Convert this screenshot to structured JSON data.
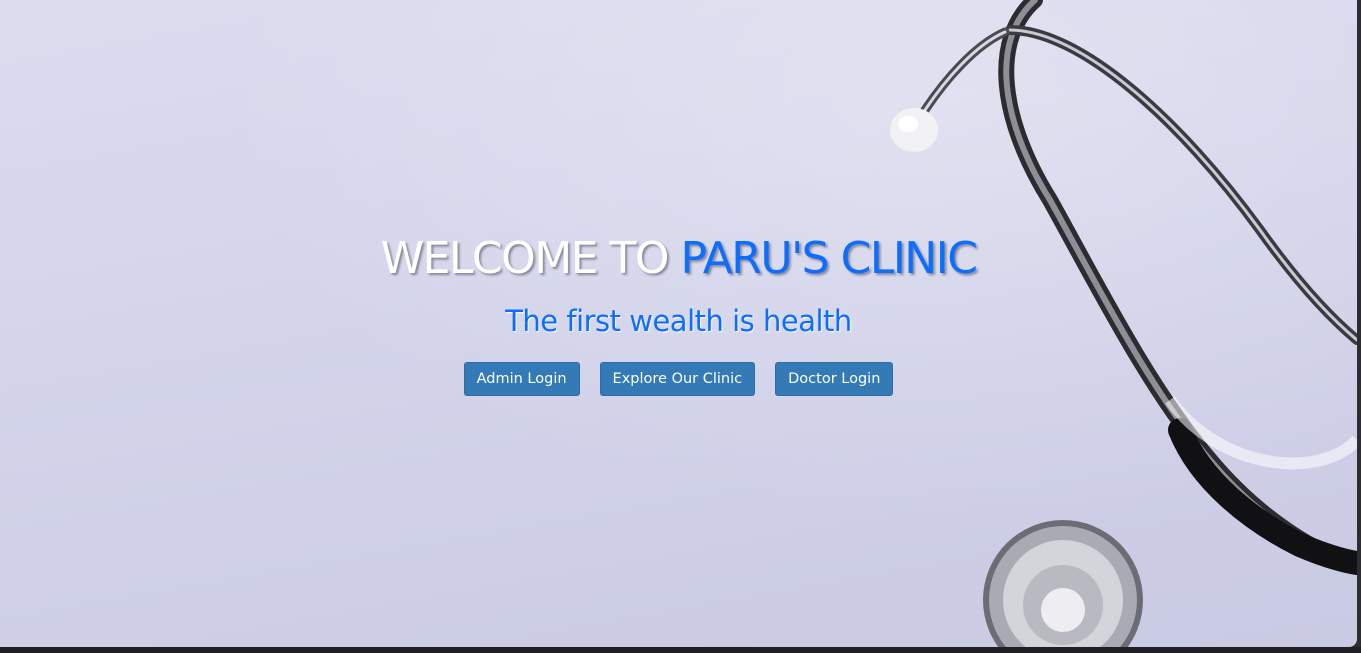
{
  "hero": {
    "title_prefix": "WELCOME TO ",
    "title_highlight": "PARU'S CLINIC",
    "tagline": "The first wealth is health"
  },
  "buttons": {
    "admin_login": "Admin Login",
    "explore_clinic": "Explore Our Clinic",
    "doctor_login": "Doctor Login"
  },
  "colors": {
    "accent_blue": "#0d6efd",
    "button_blue": "#337ab7",
    "background": "#d3d4ea"
  },
  "icons": {
    "background_image": "stethoscope-image"
  }
}
